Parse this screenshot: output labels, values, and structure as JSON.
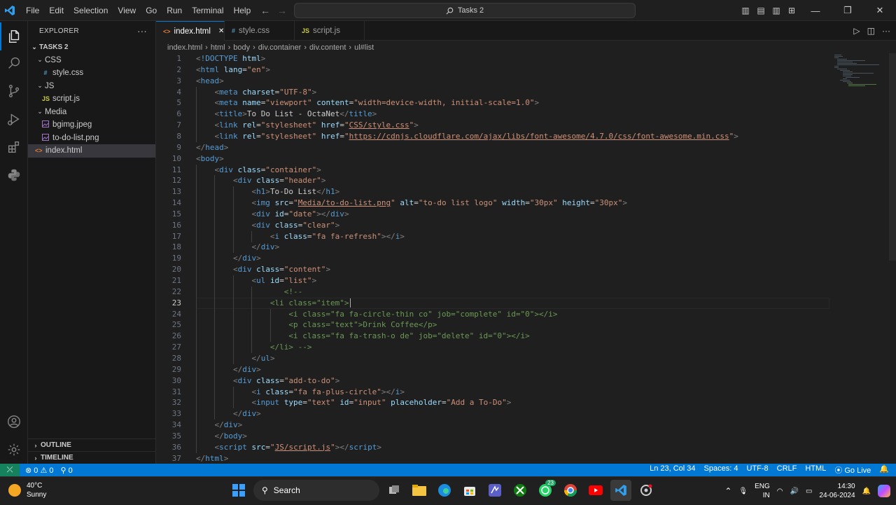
{
  "titlebar": {
    "menu": [
      "File",
      "Edit",
      "Selection",
      "View",
      "Go",
      "Run",
      "Terminal",
      "Help"
    ],
    "search": "Tasks 2"
  },
  "sidebar": {
    "title": "EXPLORER",
    "more": "···",
    "project": "TASKS 2",
    "tree": [
      {
        "label": "CSS",
        "type": "folder",
        "depth": 1
      },
      {
        "label": "style.css",
        "type": "css",
        "depth": 2,
        "icon": "#"
      },
      {
        "label": "JS",
        "type": "folder",
        "depth": 1
      },
      {
        "label": "script.js",
        "type": "js",
        "depth": 2,
        "icon": "JS"
      },
      {
        "label": "Media",
        "type": "folder",
        "depth": 1
      },
      {
        "label": "bgimg.jpeg",
        "type": "img",
        "depth": 2
      },
      {
        "label": "to-do-list.png",
        "type": "img",
        "depth": 2
      },
      {
        "label": "index.html",
        "type": "html",
        "depth": 1,
        "selected": true,
        "icon": "<>"
      }
    ],
    "outline": "OUTLINE",
    "timeline": "TIMELINE"
  },
  "tabs": [
    {
      "label": "index.html",
      "icon": "<>",
      "active": true
    },
    {
      "label": "style.css",
      "icon": "#",
      "active": false
    },
    {
      "label": "script.js",
      "icon": "JS",
      "active": false
    }
  ],
  "breadcrumb": [
    "index.html",
    "html",
    "body",
    "div.container",
    "div.content",
    "ul#list"
  ],
  "editor": {
    "current_line": 23,
    "lines": [
      {
        "n": 1,
        "ind": 0,
        "tokens": [
          [
            "p",
            "<"
          ],
          [
            "t",
            "!DOCTYPE"
          ],
          [
            "tx",
            " "
          ],
          [
            "a",
            "html"
          ],
          [
            "p",
            ">"
          ]
        ]
      },
      {
        "n": 2,
        "ind": 0,
        "tokens": [
          [
            "p",
            "<"
          ],
          [
            "t",
            "html"
          ],
          [
            "tx",
            " "
          ],
          [
            "a",
            "lang"
          ],
          [
            "tx",
            "="
          ],
          [
            "s",
            "\"en\""
          ],
          [
            "p",
            ">"
          ]
        ]
      },
      {
        "n": 3,
        "ind": 0,
        "tokens": [
          [
            "p",
            "<"
          ],
          [
            "t",
            "head"
          ],
          [
            "p",
            ">"
          ]
        ]
      },
      {
        "n": 4,
        "ind": 1,
        "tokens": [
          [
            "p",
            "<"
          ],
          [
            "t",
            "meta"
          ],
          [
            "tx",
            " "
          ],
          [
            "a",
            "charset"
          ],
          [
            "tx",
            "="
          ],
          [
            "s",
            "\"UTF-8\""
          ],
          [
            "p",
            ">"
          ]
        ]
      },
      {
        "n": 5,
        "ind": 1,
        "tokens": [
          [
            "p",
            "<"
          ],
          [
            "t",
            "meta"
          ],
          [
            "tx",
            " "
          ],
          [
            "a",
            "name"
          ],
          [
            "tx",
            "="
          ],
          [
            "s",
            "\"viewport\""
          ],
          [
            "tx",
            " "
          ],
          [
            "a",
            "content"
          ],
          [
            "tx",
            "="
          ],
          [
            "s",
            "\"width=device-width, initial-scale=1.0\""
          ],
          [
            "p",
            ">"
          ]
        ]
      },
      {
        "n": 6,
        "ind": 1,
        "tokens": [
          [
            "p",
            "<"
          ],
          [
            "t",
            "title"
          ],
          [
            "p",
            ">"
          ],
          [
            "tx",
            "To Do List - OctaNet"
          ],
          [
            "p",
            "</"
          ],
          [
            "t",
            "title"
          ],
          [
            "p",
            ">"
          ]
        ]
      },
      {
        "n": 7,
        "ind": 1,
        "tokens": [
          [
            "p",
            "<"
          ],
          [
            "t",
            "link"
          ],
          [
            "tx",
            " "
          ],
          [
            "a",
            "rel"
          ],
          [
            "tx",
            "="
          ],
          [
            "s",
            "\"stylesheet\""
          ],
          [
            "tx",
            " "
          ],
          [
            "a",
            "href"
          ],
          [
            "tx",
            "="
          ],
          [
            "s",
            "\""
          ],
          [
            "su",
            "CSS/style.css"
          ],
          [
            "s",
            "\""
          ],
          [
            "p",
            ">"
          ]
        ]
      },
      {
        "n": 8,
        "ind": 1,
        "tokens": [
          [
            "p",
            "<"
          ],
          [
            "t",
            "link"
          ],
          [
            "tx",
            " "
          ],
          [
            "a",
            "rel"
          ],
          [
            "tx",
            "="
          ],
          [
            "s",
            "\"stylesheet\""
          ],
          [
            "tx",
            " "
          ],
          [
            "a",
            "href"
          ],
          [
            "tx",
            "="
          ],
          [
            "s",
            "\""
          ],
          [
            "su",
            "https://cdnjs.cloudflare.com/ajax/libs/font-awesome/4.7.0/css/font-awesome.min.css"
          ],
          [
            "s",
            "\""
          ],
          [
            "p",
            ">"
          ]
        ]
      },
      {
        "n": 9,
        "ind": 0,
        "tokens": [
          [
            "p",
            "</"
          ],
          [
            "t",
            "head"
          ],
          [
            "p",
            ">"
          ]
        ]
      },
      {
        "n": 10,
        "ind": 0,
        "tokens": [
          [
            "p",
            "<"
          ],
          [
            "t",
            "body"
          ],
          [
            "p",
            ">"
          ]
        ]
      },
      {
        "n": 11,
        "ind": 1,
        "tokens": [
          [
            "p",
            "<"
          ],
          [
            "t",
            "div"
          ],
          [
            "tx",
            " "
          ],
          [
            "a",
            "class"
          ],
          [
            "tx",
            "="
          ],
          [
            "s",
            "\"container\""
          ],
          [
            "p",
            ">"
          ]
        ]
      },
      {
        "n": 12,
        "ind": 2,
        "tokens": [
          [
            "p",
            "<"
          ],
          [
            "t",
            "div"
          ],
          [
            "tx",
            " "
          ],
          [
            "a",
            "class"
          ],
          [
            "tx",
            "="
          ],
          [
            "s",
            "\"header\""
          ],
          [
            "p",
            ">"
          ]
        ]
      },
      {
        "n": 13,
        "ind": 3,
        "tokens": [
          [
            "p",
            "<"
          ],
          [
            "t",
            "h1"
          ],
          [
            "p",
            ">"
          ],
          [
            "tx",
            "To-Do List"
          ],
          [
            "p",
            "</"
          ],
          [
            "t",
            "h1"
          ],
          [
            "p",
            ">"
          ]
        ]
      },
      {
        "n": 14,
        "ind": 3,
        "tokens": [
          [
            "p",
            "<"
          ],
          [
            "t",
            "img"
          ],
          [
            "tx",
            " "
          ],
          [
            "a",
            "src"
          ],
          [
            "tx",
            "="
          ],
          [
            "s",
            "\""
          ],
          [
            "su",
            "Media/to-do-list.png"
          ],
          [
            "s",
            "\""
          ],
          [
            "tx",
            " "
          ],
          [
            "a",
            "alt"
          ],
          [
            "tx",
            "="
          ],
          [
            "s",
            "\"to-do list logo\""
          ],
          [
            "tx",
            " "
          ],
          [
            "a",
            "width"
          ],
          [
            "tx",
            "="
          ],
          [
            "s",
            "\"30px\""
          ],
          [
            "tx",
            " "
          ],
          [
            "a",
            "height"
          ],
          [
            "tx",
            "="
          ],
          [
            "s",
            "\"30px\""
          ],
          [
            "p",
            ">"
          ]
        ]
      },
      {
        "n": 15,
        "ind": 3,
        "tokens": [
          [
            "p",
            "<"
          ],
          [
            "t",
            "div"
          ],
          [
            "tx",
            " "
          ],
          [
            "a",
            "id"
          ],
          [
            "tx",
            "="
          ],
          [
            "s",
            "\"date\""
          ],
          [
            "p",
            "></"
          ],
          [
            "t",
            "div"
          ],
          [
            "p",
            ">"
          ]
        ]
      },
      {
        "n": 16,
        "ind": 3,
        "tokens": [
          [
            "p",
            "<"
          ],
          [
            "t",
            "div"
          ],
          [
            "tx",
            " "
          ],
          [
            "a",
            "class"
          ],
          [
            "tx",
            "="
          ],
          [
            "s",
            "\"clear\""
          ],
          [
            "p",
            ">"
          ]
        ]
      },
      {
        "n": 17,
        "ind": 4,
        "tokens": [
          [
            "p",
            "<"
          ],
          [
            "t",
            "i"
          ],
          [
            "tx",
            " "
          ],
          [
            "a",
            "class"
          ],
          [
            "tx",
            "="
          ],
          [
            "s",
            "\"fa fa-refresh\""
          ],
          [
            "p",
            "></"
          ],
          [
            "t",
            "i"
          ],
          [
            "p",
            ">"
          ]
        ]
      },
      {
        "n": 18,
        "ind": 3,
        "tokens": [
          [
            "p",
            "</"
          ],
          [
            "t",
            "div"
          ],
          [
            "p",
            ">"
          ]
        ]
      },
      {
        "n": 19,
        "ind": 2,
        "tokens": [
          [
            "p",
            "</"
          ],
          [
            "t",
            "div"
          ],
          [
            "p",
            ">"
          ]
        ]
      },
      {
        "n": 20,
        "ind": 2,
        "tokens": [
          [
            "p",
            "<"
          ],
          [
            "t",
            "div"
          ],
          [
            "tx",
            " "
          ],
          [
            "a",
            "class"
          ],
          [
            "tx",
            "="
          ],
          [
            "s",
            "\"content\""
          ],
          [
            "p",
            ">"
          ]
        ]
      },
      {
        "n": 21,
        "ind": 3,
        "tokens": [
          [
            "p",
            "<"
          ],
          [
            "t",
            "ul"
          ],
          [
            "tx",
            " "
          ],
          [
            "a",
            "id"
          ],
          [
            "tx",
            "="
          ],
          [
            "s",
            "\"list\""
          ],
          [
            "p",
            ">"
          ]
        ]
      },
      {
        "n": 22,
        "ind": 4,
        "pre": "   ",
        "tokens": [
          [
            "c",
            "<!--"
          ]
        ]
      },
      {
        "n": 23,
        "ind": 4,
        "tokens": [
          [
            "c",
            "<li class=\"item\">"
          ]
        ]
      },
      {
        "n": 24,
        "ind": 5,
        "tokens": [
          [
            "c",
            "<i class=\"fa fa-circle-thin co\" job=\"complete\" id=\"0\"></i>"
          ]
        ]
      },
      {
        "n": 25,
        "ind": 5,
        "tokens": [
          [
            "c",
            "<p class=\"text\">Drink Coffee</p>"
          ]
        ]
      },
      {
        "n": 26,
        "ind": 5,
        "tokens": [
          [
            "c",
            "<i class=\"fa fa-trash-o de\" job=\"delete\" id=\"0\"></i>"
          ]
        ]
      },
      {
        "n": 27,
        "ind": 4,
        "tokens": [
          [
            "c",
            "</li> -->"
          ]
        ]
      },
      {
        "n": 28,
        "ind": 3,
        "tokens": [
          [
            "p",
            "</"
          ],
          [
            "t",
            "ul"
          ],
          [
            "p",
            ">"
          ]
        ]
      },
      {
        "n": 29,
        "ind": 2,
        "tokens": [
          [
            "p",
            "</"
          ],
          [
            "t",
            "div"
          ],
          [
            "p",
            ">"
          ]
        ]
      },
      {
        "n": 30,
        "ind": 2,
        "tokens": [
          [
            "p",
            "<"
          ],
          [
            "t",
            "div"
          ],
          [
            "tx",
            " "
          ],
          [
            "a",
            "class"
          ],
          [
            "tx",
            "="
          ],
          [
            "s",
            "\"add-to-do\""
          ],
          [
            "p",
            ">"
          ]
        ]
      },
      {
        "n": 31,
        "ind": 3,
        "tokens": [
          [
            "p",
            "<"
          ],
          [
            "t",
            "i"
          ],
          [
            "tx",
            " "
          ],
          [
            "a",
            "class"
          ],
          [
            "tx",
            "="
          ],
          [
            "s",
            "\"fa fa-plus-circle\""
          ],
          [
            "p",
            "></"
          ],
          [
            "t",
            "i"
          ],
          [
            "p",
            ">"
          ]
        ]
      },
      {
        "n": 32,
        "ind": 3,
        "tokens": [
          [
            "p",
            "<"
          ],
          [
            "t",
            "input"
          ],
          [
            "tx",
            " "
          ],
          [
            "a",
            "type"
          ],
          [
            "tx",
            "="
          ],
          [
            "s",
            "\"text\""
          ],
          [
            "tx",
            " "
          ],
          [
            "a",
            "id"
          ],
          [
            "tx",
            "="
          ],
          [
            "s",
            "\"input\""
          ],
          [
            "tx",
            " "
          ],
          [
            "a",
            "placeholder"
          ],
          [
            "tx",
            "="
          ],
          [
            "s",
            "\"Add a To-Do\""
          ],
          [
            "p",
            ">"
          ]
        ]
      },
      {
        "n": 33,
        "ind": 2,
        "tokens": [
          [
            "p",
            "</"
          ],
          [
            "t",
            "div"
          ],
          [
            "p",
            ">"
          ]
        ]
      },
      {
        "n": 34,
        "ind": 1,
        "tokens": [
          [
            "p",
            "</"
          ],
          [
            "t",
            "div"
          ],
          [
            "p",
            ">"
          ]
        ]
      },
      {
        "n": 35,
        "ind": 1,
        "tokens": [
          [
            "p",
            "</"
          ],
          [
            "t",
            "body"
          ],
          [
            "p",
            ">"
          ]
        ]
      },
      {
        "n": 36,
        "ind": 1,
        "tokens": [
          [
            "p",
            "<"
          ],
          [
            "t",
            "script"
          ],
          [
            "tx",
            " "
          ],
          [
            "a",
            "src"
          ],
          [
            "tx",
            "="
          ],
          [
            "s",
            "\""
          ],
          [
            "su",
            "JS/script.js"
          ],
          [
            "s",
            "\""
          ],
          [
            "p",
            "></"
          ],
          [
            "t",
            "script"
          ],
          [
            "p",
            ">"
          ]
        ]
      },
      {
        "n": 37,
        "ind": 0,
        "tokens": [
          [
            "p",
            "</"
          ],
          [
            "t",
            "html"
          ],
          [
            "p",
            ">"
          ]
        ]
      }
    ]
  },
  "status": {
    "errors": "0",
    "warnings": "0",
    "ports": "0",
    "position": "Ln 23, Col 34",
    "spaces": "Spaces: 4",
    "encoding": "UTF-8",
    "eol": "CRLF",
    "language": "HTML",
    "golive": "Go Live"
  },
  "taskbar": {
    "temperature": "40°C",
    "condition": "Sunny",
    "search": "Search",
    "whatsapp_badge": "23",
    "lang1": "ENG",
    "lang2": "IN",
    "time": "14:30",
    "date": "24-06-2024"
  },
  "colors": {
    "accent": "#0078d4",
    "statusbar": "#0078d4",
    "remote": "#16825d"
  }
}
